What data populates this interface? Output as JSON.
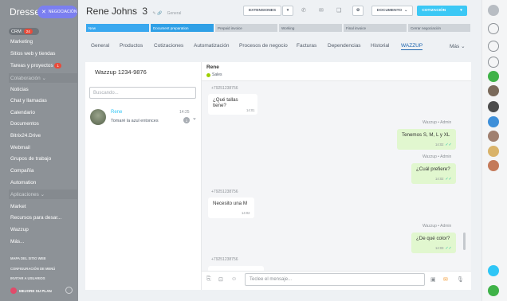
{
  "sidebar": {
    "brand": "Dresse",
    "pill_label": "NEGOCIACIÓN",
    "crm_label": "CRM",
    "crm_badge": "24",
    "items": [
      {
        "label": "Marketing",
        "dim": false
      },
      {
        "label": "Sitios web y tiendas",
        "dim": false
      },
      {
        "label": "Tareas y proyectos",
        "badge": "1",
        "dim": false
      },
      {
        "label": "Colaboración",
        "dim": true
      },
      {
        "label": "Noticias",
        "dim": false
      },
      {
        "label": "Chat y llamadas",
        "dim": false
      },
      {
        "label": "Calendario",
        "dim": false
      },
      {
        "label": "Documentos",
        "dim": false
      },
      {
        "label": "Bitrix24.Drive",
        "dim": false
      },
      {
        "label": "Webmail",
        "dim": false
      },
      {
        "label": "Grupos de trabajo",
        "dim": false
      },
      {
        "label": "Compañía",
        "dim": false
      },
      {
        "label": "Automation",
        "dim": false
      },
      {
        "label": "Aplicaciones",
        "dim": true
      },
      {
        "label": "Market",
        "dim": false
      },
      {
        "label": "Recursos para desar...",
        "dim": false
      },
      {
        "label": "Wazzup",
        "dim": false
      },
      {
        "label": "Más...",
        "dim": false
      }
    ],
    "footer_links": [
      "MAPA DEL SITIO WEB",
      "CONFIGURACIÓN DE MENÚ",
      "INVITAR A USUARIOS"
    ],
    "plan_label": "MEJORE SU PLAN"
  },
  "header": {
    "title": "Rene Johns",
    "number": "3",
    "subtitle": "General",
    "buttons": {
      "extensions": "EXTENSIONES",
      "document": "DOCUMENTO",
      "quote": "COTIZACIÓN"
    }
  },
  "stages": [
    {
      "label": "New",
      "color": "#39a8ef"
    },
    {
      "label": "Document preparation",
      "color": "#2fa0e6"
    },
    {
      "label": "Prepaid invoice",
      "color": "#cfd4d9"
    },
    {
      "label": "Working",
      "color": "#cfd4d9"
    },
    {
      "label": "Final invoice",
      "color": "#cfd4d9"
    },
    {
      "label": "Cerrar negociación",
      "color": "#cfd4d9"
    }
  ],
  "tabs": [
    "General",
    "Productos",
    "Cotizaciones",
    "Automatización",
    "Procesos de negocio",
    "Facturas",
    "Dependencias",
    "Historial",
    "WAZZUP",
    "Más"
  ],
  "chat": {
    "title": "Wazzup 1234-9876",
    "search_placeholder": "Buscando...",
    "contact": {
      "name": "Rene",
      "time": "14:25",
      "preview": "Tomaré la azul entonces",
      "count": "1"
    },
    "header_name": "Rene",
    "header_status": "Sales",
    "messages": [
      {
        "dir": "in",
        "sender": "+79251238756",
        "text": "¿Qué tallas tiene?",
        "time": "14:01"
      },
      {
        "dir": "out",
        "sender": "Wazzup • Admin",
        "text": "Tenemos S, M, L y XL",
        "time": "14:02"
      },
      {
        "dir": "out",
        "sender": "Wazzup • Admin",
        "text": "¿Cuál prefiere?",
        "time": "14:02"
      },
      {
        "dir": "in",
        "sender": "+79251238756",
        "text": "Necesito una M",
        "time": "14:02"
      },
      {
        "dir": "out",
        "sender": "Wazzup • Admin",
        "text": "¿De qué color?",
        "time": "14:03"
      },
      {
        "dir": "in",
        "sender": "+79251238756",
        "text": "",
        "time": ""
      }
    ],
    "input_placeholder": "Teclee el mensaje..."
  }
}
